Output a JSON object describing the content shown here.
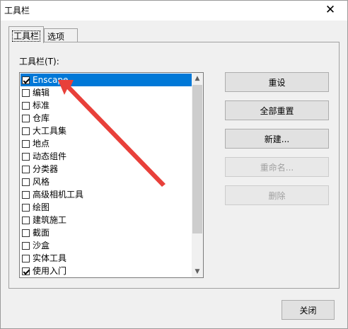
{
  "window": {
    "title": "工具栏"
  },
  "tabs": [
    {
      "label": "工具栏"
    },
    {
      "label": "选项"
    }
  ],
  "list": {
    "heading": "工具栏(T):",
    "items": [
      {
        "label": "Enscape",
        "checked": true
      },
      {
        "label": "编辑",
        "checked": false
      },
      {
        "label": "标准",
        "checked": false
      },
      {
        "label": "仓库",
        "checked": false
      },
      {
        "label": "大工具集",
        "checked": false
      },
      {
        "label": "地点",
        "checked": false
      },
      {
        "label": "动态组件",
        "checked": false
      },
      {
        "label": "分类器",
        "checked": false
      },
      {
        "label": "风格",
        "checked": false
      },
      {
        "label": "高级相机工具",
        "checked": false
      },
      {
        "label": "绘图",
        "checked": false
      },
      {
        "label": "建筑施工",
        "checked": false
      },
      {
        "label": "截面",
        "checked": false
      },
      {
        "label": "沙盒",
        "checked": false
      },
      {
        "label": "实体工具",
        "checked": false
      },
      {
        "label": "使用入门",
        "checked": true
      }
    ]
  },
  "buttons": {
    "reset": "重设",
    "reset_all": "全部重置",
    "new": "新建...",
    "rename": "重命名...",
    "delete": "删除",
    "close": "关闭"
  },
  "annotation": {
    "color": "#e8403a"
  }
}
